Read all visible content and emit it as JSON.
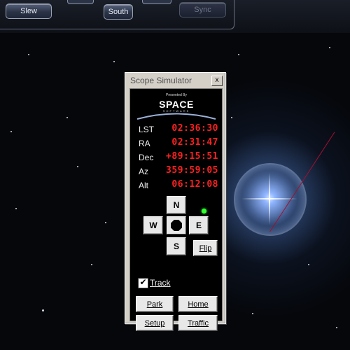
{
  "toolbar": {
    "slew_label": "Slew",
    "south_label": "South",
    "sync_label": "Sync"
  },
  "window": {
    "title": "Scope Simulator",
    "close_glyph": "x"
  },
  "logo": {
    "presented": "Presented By",
    "brand": "SPACE",
    "tagline": "SOFTWARE"
  },
  "readouts": [
    {
      "label": "LST",
      "value": "02:36:30"
    },
    {
      "label": "RA",
      "value": "02:31:47"
    },
    {
      "label": "Dec",
      "value": "+89:15:51"
    },
    {
      "label": "Az",
      "value": "359:59:05"
    },
    {
      "label": "Alt",
      "value": "06:12:08"
    }
  ],
  "direction": {
    "north": "N",
    "west": "W",
    "east": "E",
    "south": "S"
  },
  "buttons": {
    "flip": "Flip",
    "park": "Park",
    "home": "Home",
    "setup": "Setup",
    "traffic": "Traffic"
  },
  "track": {
    "label": "Track",
    "checked_glyph": "✔"
  },
  "colors": {
    "readout_red": "#ff2020",
    "led_green": "#30ff30"
  }
}
